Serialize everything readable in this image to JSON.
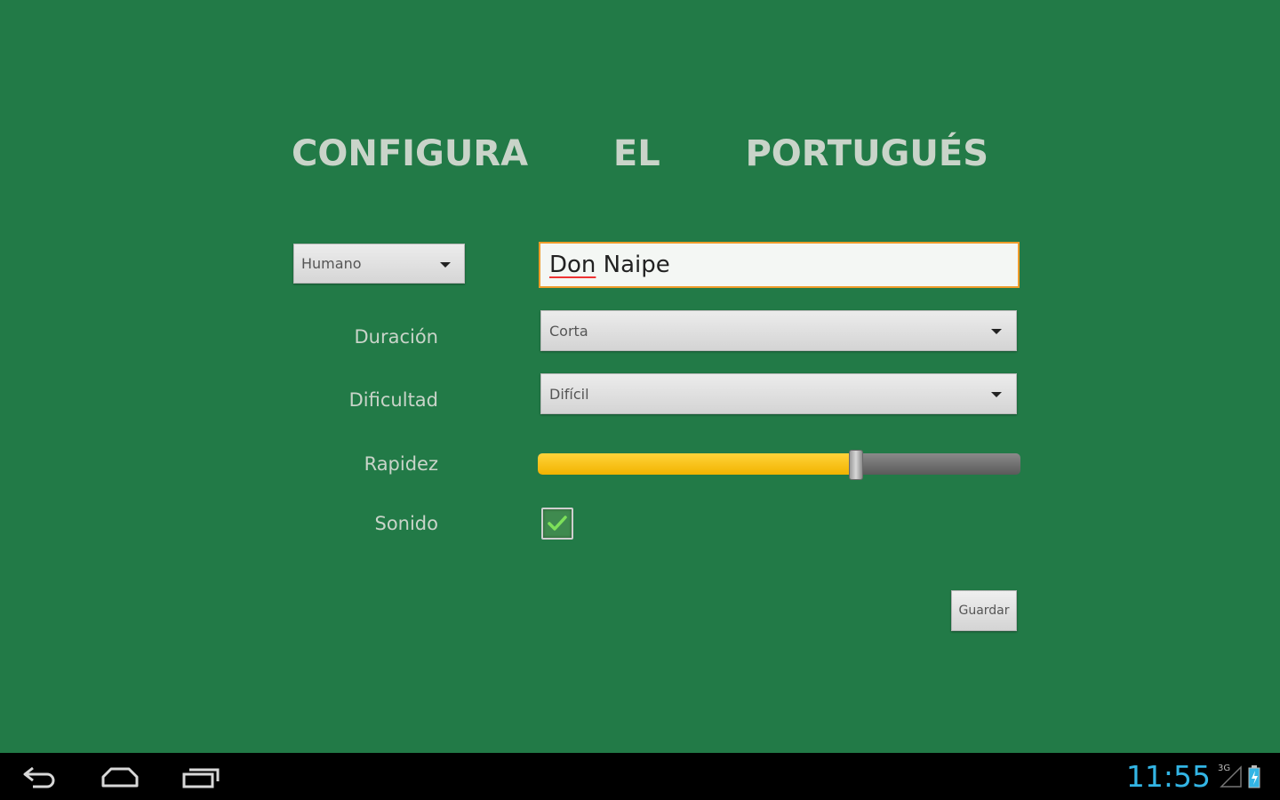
{
  "screen": {
    "title": "CONFIGURA   EL   PORTUGUÉS"
  },
  "form": {
    "player_type": {
      "selected": "Humano"
    },
    "player_name": {
      "first_word": "Don",
      "second_word": " Naipe"
    },
    "duration": {
      "label": "Duración",
      "selected": "Corta"
    },
    "difficulty": {
      "label": "Dificultad",
      "selected": "Difícil"
    },
    "speed": {
      "label": "Rapidez",
      "value_percent": 66
    },
    "sound": {
      "label": "Sonido",
      "checked": true
    },
    "save_label": "Guardar"
  },
  "system_bar": {
    "clock": "11:55",
    "network_type": "3G",
    "icons": [
      "back-icon",
      "home-icon",
      "recent-apps-icon",
      "signal-icon",
      "battery-icon"
    ]
  },
  "colors": {
    "background": "#227a47",
    "input_focus_border": "#ee9c2a",
    "slider_fill": "#f5bd00",
    "clock": "#33b5e5"
  }
}
